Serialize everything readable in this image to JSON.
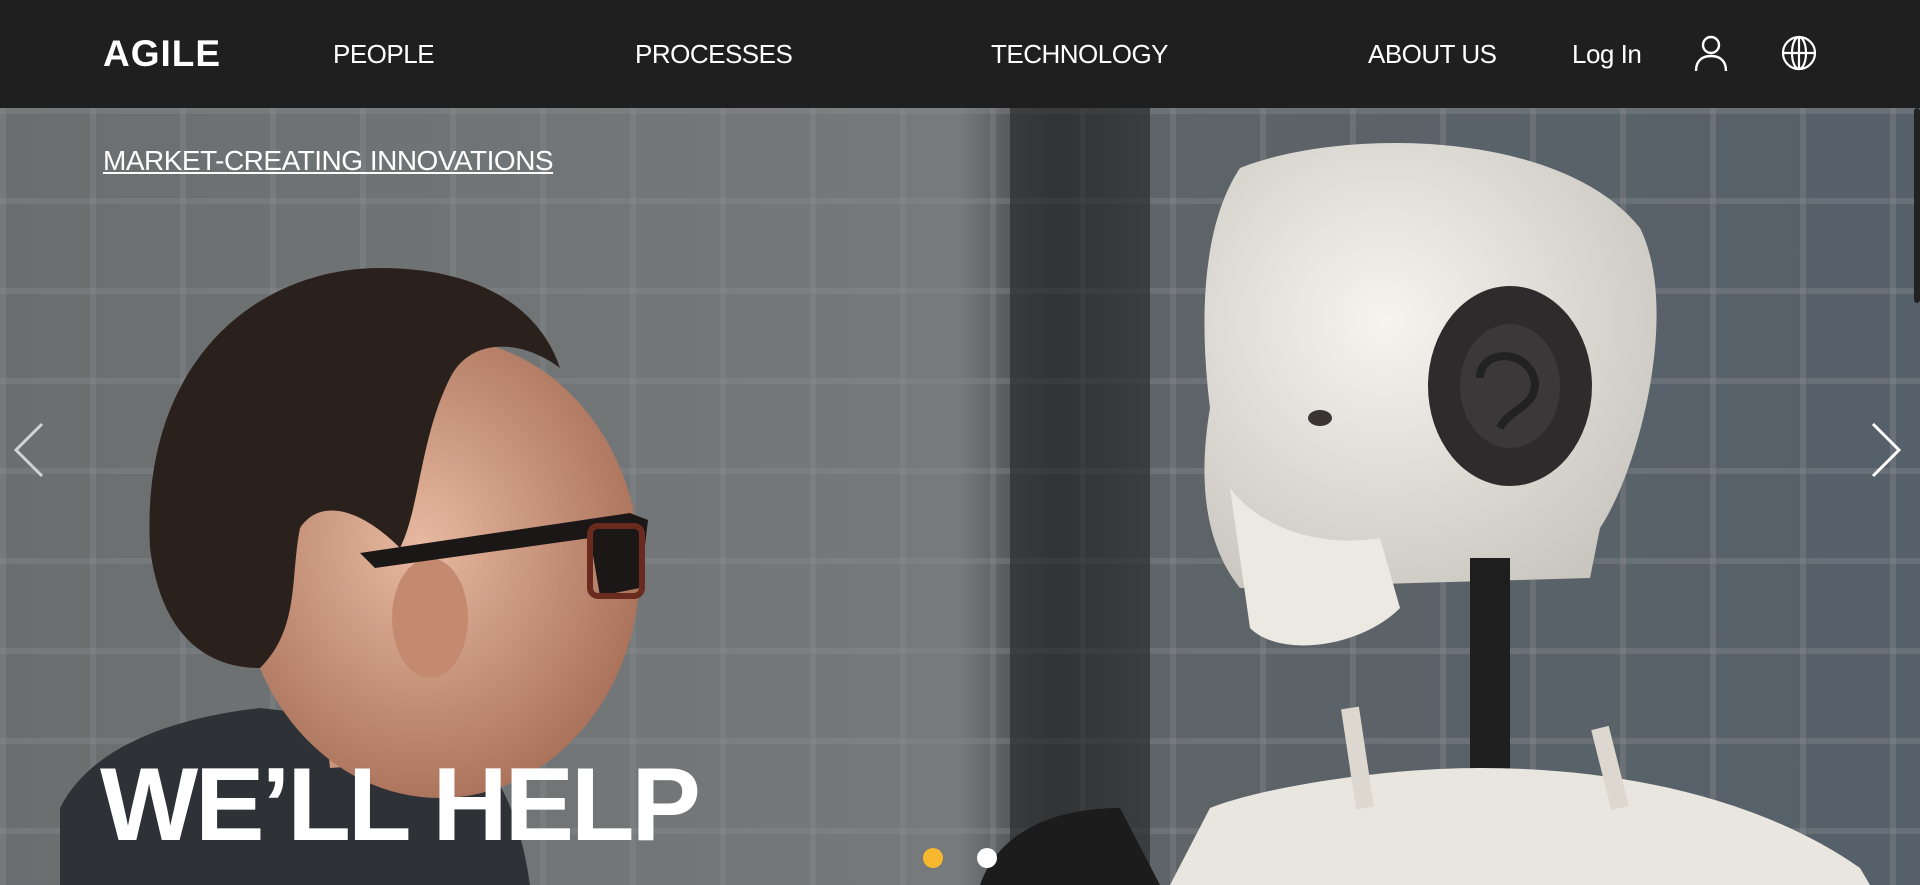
{
  "header": {
    "logo": "AGILE",
    "nav": [
      {
        "label": "PEOPLE"
      },
      {
        "label": "PROCESSES"
      },
      {
        "label": "TECHNOLOGY"
      },
      {
        "label": "ABOUT US"
      }
    ],
    "login_label": "Log In",
    "icons": [
      "user-icon",
      "globe-icon"
    ]
  },
  "hero": {
    "kicker": "MARKET-CREATING INNOVATIONS",
    "headline": "WE’LL HELP",
    "carousel": {
      "slide_count": 2,
      "active_index": 0,
      "active_color": "#f5b82e",
      "inactive_color": "#ffffff"
    }
  },
  "colors": {
    "topbar": "#1f1f1f",
    "text": "#ffffff"
  }
}
